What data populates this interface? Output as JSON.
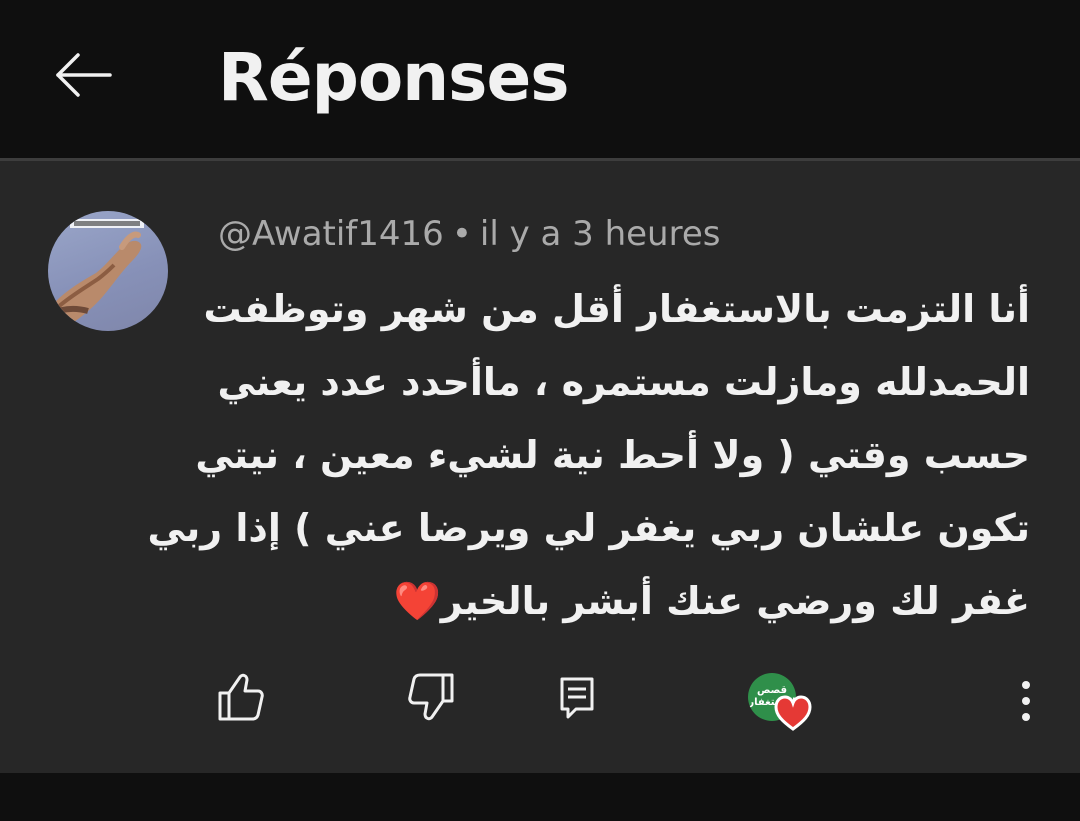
{
  "header": {
    "title": "Réponses",
    "back_icon": "arrow-left-icon"
  },
  "comment": {
    "author": "@Awatif1416",
    "separator": "•",
    "timestamp": "il y a 3 heures",
    "lines": [
      "أنا التزمت بالاستغفار أقل من شهر وتوظفت",
      "الحمدلله ومازلت مستمره ، ماأحدد عدد يعني",
      "حسب وقتي ( ولا أحط نية لشيء معين ، نيتي",
      "تكون علشان ربي يغفر لي ويرضا عني ) إذا ربي",
      "غفر لك ورضي عنك أبشر بالخير"
    ],
    "emoji": "❤️",
    "actions": {
      "like_icon": "thumbs-up-icon",
      "dislike_icon": "thumbs-down-icon",
      "reply_icon": "reply-comment-icon",
      "more_icon": "more-vertical-icon"
    },
    "creator_heart": {
      "channel_avatar_text_line1": "قصص",
      "channel_avatar_text_line2": "الاستغفار",
      "icon": "heart-icon",
      "avatar_color": "#2f8f4a",
      "heart_color": "#e53935"
    }
  },
  "colors": {
    "background": "#0f0f0f",
    "card": "#272727",
    "text_primary": "#f1f1f1",
    "text_secondary": "#aaaaaa"
  }
}
